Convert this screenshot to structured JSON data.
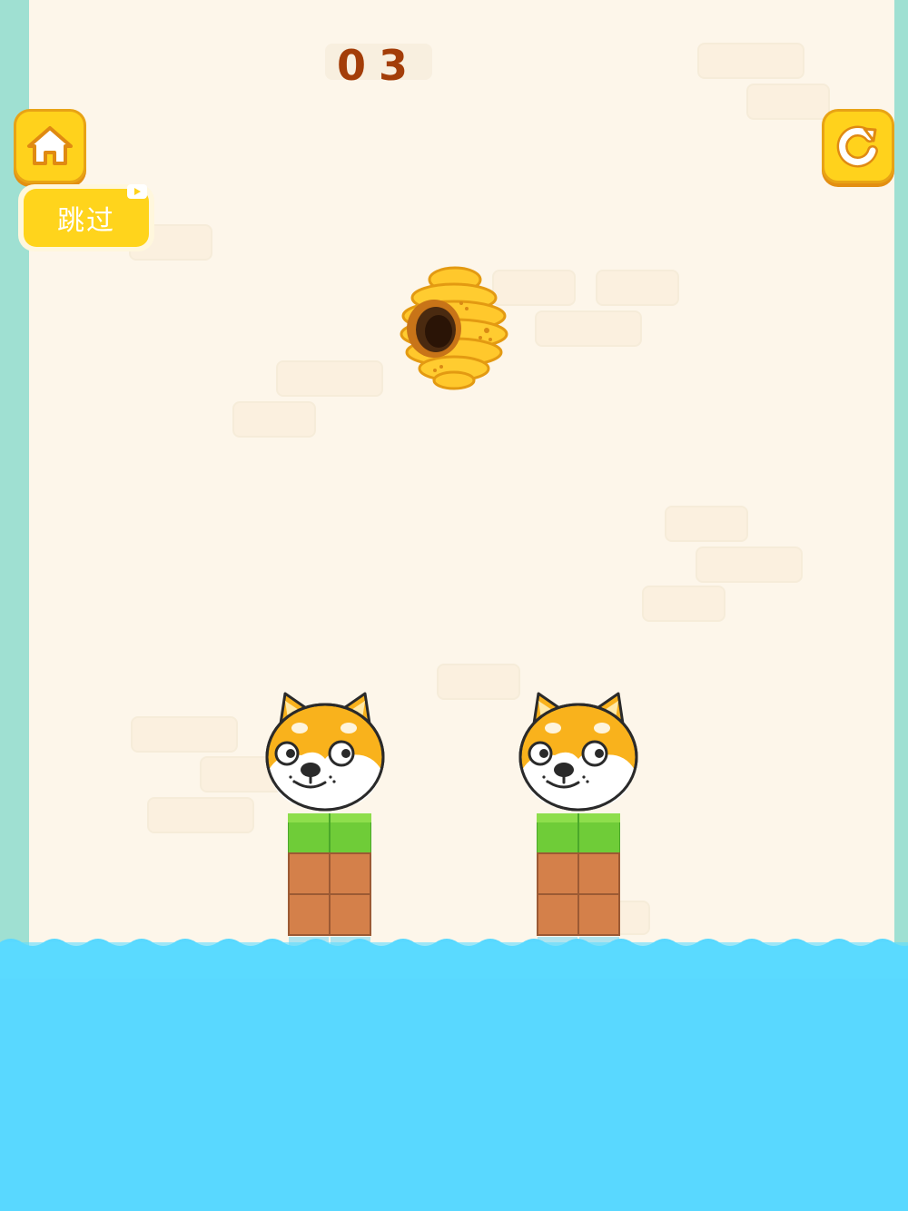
{
  "game": {
    "level_label": "03"
  },
  "buttons": {
    "home_icon": "home-icon",
    "restart_icon": "restart-icon",
    "skip_label": "跳过",
    "skip_badge_icon": "video-play-icon"
  },
  "scene": {
    "hive": "beehive",
    "dogs": [
      "shiba-dog",
      "shiba-dog"
    ],
    "pillars": [
      "grass-brick-pillar",
      "grass-brick-pillar"
    ]
  },
  "colors": {
    "accent": "#ffd21c",
    "level_text": "#a33d08",
    "background": "#fdf6ea",
    "wall": "#9fe0d2",
    "water": "#59d8ff",
    "grass": "#6fcc38",
    "brick": "#d4804a"
  }
}
